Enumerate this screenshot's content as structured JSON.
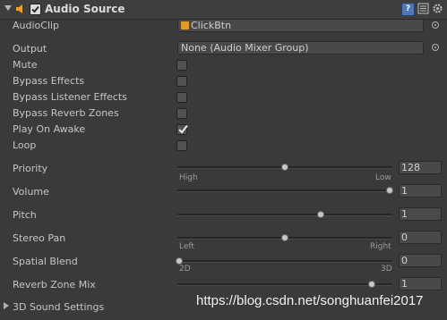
{
  "header": {
    "title": "Audio Source",
    "help_label": "?",
    "foldout_icon": "foldout-down-icon",
    "component_icon": "speaker-icon",
    "enabled": true
  },
  "fields": {
    "audio_clip": {
      "label": "AudioClip",
      "value": "ClickBtn",
      "icon": "audio-clip-icon"
    },
    "output": {
      "label": "Output",
      "value": "None (Audio Mixer Group)"
    }
  },
  "toggles": [
    {
      "label": "Mute",
      "checked": false
    },
    {
      "label": "Bypass Effects",
      "checked": false
    },
    {
      "label": "Bypass Listener Effects",
      "checked": false
    },
    {
      "label": "Bypass Reverb Zones",
      "checked": false
    },
    {
      "label": "Play On Awake",
      "checked": true
    },
    {
      "label": "Loop",
      "checked": false
    }
  ],
  "sliders": {
    "priority": {
      "label": "Priority",
      "value": "128",
      "level": 0.5,
      "min_label": "High",
      "max_label": "Low"
    },
    "volume": {
      "label": "Volume",
      "value": "1",
      "level": 1.0
    },
    "pitch": {
      "label": "Pitch",
      "value": "1",
      "level": 0.667
    },
    "stereo_pan": {
      "label": "Stereo Pan",
      "value": "0",
      "level": 0.5,
      "min_label": "Left",
      "max_label": "Right"
    },
    "spatial_blend": {
      "label": "Spatial Blend",
      "value": "0",
      "level": 0.0,
      "min_label": "2D",
      "max_label": "3D"
    },
    "reverb_zone_mix": {
      "label": "Reverb Zone Mix",
      "value": "1",
      "level": 1.0
    }
  },
  "foldout_3d": {
    "label": "3D Sound Settings"
  },
  "watermark": "https://blog.csdn.net/songhuanfei2017",
  "colors": {
    "background": "#3a3a3a",
    "field": "#494949",
    "text": "#c6c6c6",
    "accent": "#4f77b5",
    "clip_icon": "#e29a28"
  }
}
